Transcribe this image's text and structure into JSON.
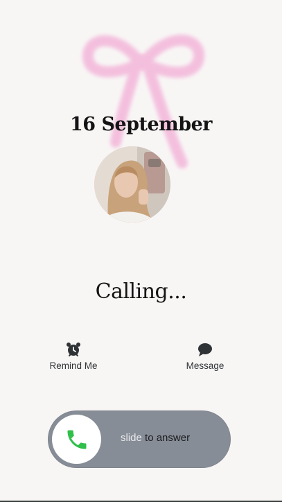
{
  "call": {
    "date": "16 September",
    "status": "Calling...",
    "avatar_icon": "contact-photo"
  },
  "actions": {
    "remind": {
      "label": "Remind Me",
      "icon": "alarm-clock-icon"
    },
    "message": {
      "label": "Message",
      "icon": "speech-bubble-icon"
    }
  },
  "slider": {
    "hint_faded": "slide",
    "hint_rest": " to answer",
    "icon": "phone-icon",
    "track_color": "#878d96",
    "accept_color": "#2fbf4a"
  },
  "decor": {
    "bow_color": "#f3b6d9"
  }
}
